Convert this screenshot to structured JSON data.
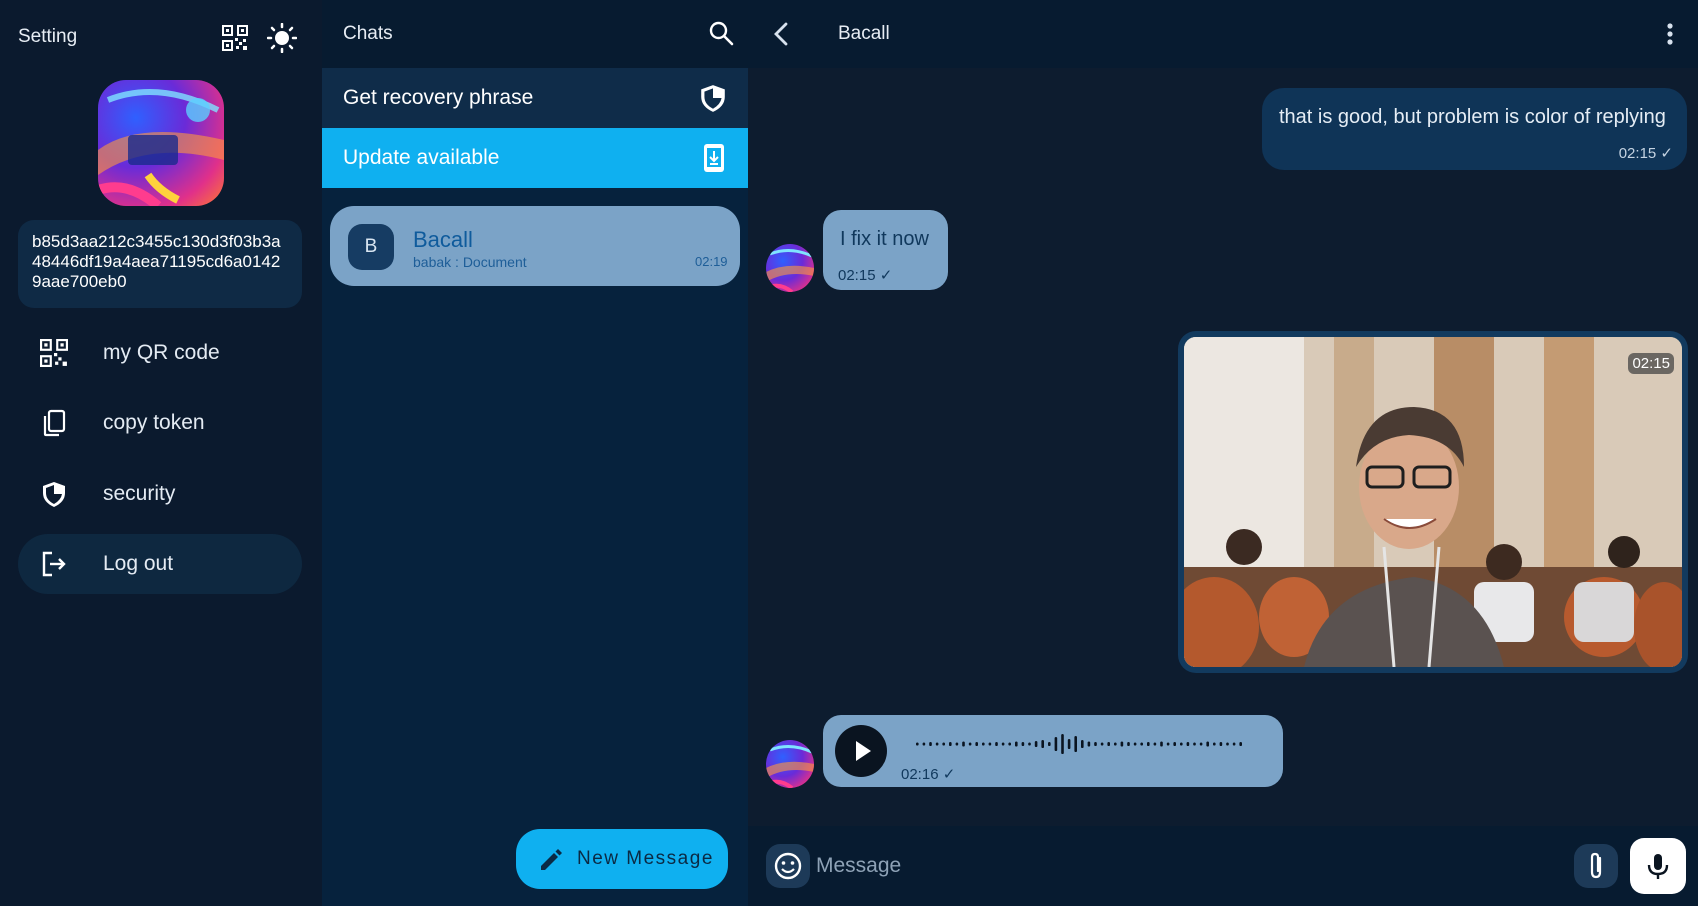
{
  "settings": {
    "title": "Setting",
    "token": "b85d3aa212c3455c130d3f03b3a48446df19a4aea71195cd6a01429aae700eb0",
    "menu": [
      {
        "label": "my QR code",
        "icon": "qr-code-icon"
      },
      {
        "label": "copy token",
        "icon": "copy-icon"
      },
      {
        "label": "security",
        "icon": "shield-icon"
      },
      {
        "label": "Log out",
        "icon": "logout-icon"
      }
    ]
  },
  "chats": {
    "title": "Chats",
    "recovery_banner": "Get recovery phrase",
    "update_banner": "Update available",
    "items": [
      {
        "avatar_letter": "B",
        "name": "Bacall",
        "preview": "babak : Document",
        "time": "02:19"
      }
    ],
    "new_message_label": "New Message"
  },
  "conversation": {
    "title": "Bacall",
    "messages": [
      {
        "direction": "out",
        "type": "text",
        "text": "that is good, but problem is color of replying",
        "meta": "02:15 ✓"
      },
      {
        "direction": "in",
        "type": "text",
        "text": "I fix it now",
        "meta": "02:15 ✓"
      },
      {
        "direction": "out",
        "type": "image",
        "time": "02:15"
      },
      {
        "direction": "in",
        "type": "voice",
        "meta": "02:16 ✓"
      }
    ],
    "composer_placeholder": "Message"
  },
  "colors": {
    "accent": "#0fb0f0",
    "incoming_bubble": "#7ba3c7",
    "outgoing_bubble": "#0f3457",
    "background": "#0d1c2f"
  }
}
